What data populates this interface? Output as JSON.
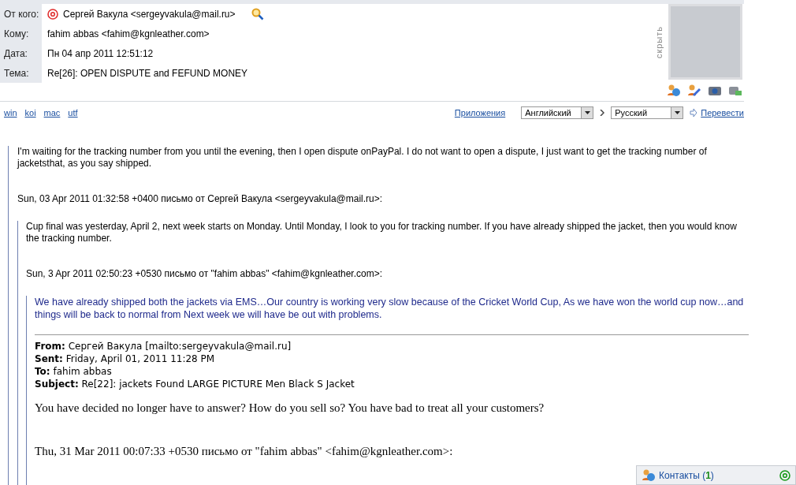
{
  "header": {
    "fields": [
      {
        "kind": "sender",
        "label": "От кого:",
        "value": "Сергей Вакула <sergeyvakula@mail.ru>"
      },
      {
        "kind": "plain",
        "label": "Кому:",
        "value": "fahim abbas <fahim@kgnleather.com>"
      },
      {
        "kind": "plain",
        "label": "Дата:",
        "value": "Пн 04 апр 2011 12:51:12"
      },
      {
        "kind": "plain",
        "label": "Тема:",
        "value": "Re[26]: OPEN DISPUTE and FEFUND MONEY"
      }
    ],
    "hide_label": "скрыть"
  },
  "toolbar": {
    "encodings": [
      "win",
      "koi",
      "mac",
      "utf"
    ],
    "attachments": "Приложения",
    "source_language": "Английский",
    "target_language": "Русский",
    "translate": "Перевести"
  },
  "body": {
    "text": "I'm waiting for the tracking number from you until the evening, then I open dispute onPayPal. I do not want to open a dispute, I just want to get the tracking number of jacketsthat, as you say shipped.",
    "quote": {
      "header": "Sun, 03 Apr 2011 01:32:58 +0400 письмо от Сергей Вакула <sergeyvakula@mail.ru>:",
      "text": "Cup final was yesterday, April 2, next week starts on Monday. Until Monday, I look to you for tracking number. If you have already shipped the jacket, then you would know the tracking number.",
      "quote": {
        "header": "Sun, 3 Apr 2011 02:50:23 +0530 письмо от \"fahim abbas\" <fahim@kgnleather.com>:",
        "text": "We have already shipped both the jackets via EMS…Our country is working very slow because of the Cricket World Cup, As we have won the world cup now…and things will be back to normal from Next week we will have be out with problems.",
        "forwarded": [
          "**From:** Сергей Вакула [mailto:sergeyvakula@mail.ru]",
          "**Sent:** Friday, April 01, 2011 11:28 PM",
          "**To:** fahim abbas",
          "**Subject:** Re[22]: jackets Found LARGE PICTURE Men Black S Jacket"
        ],
        "message": "You have decided no longer have to answer? How do you sell so? You have bad to treat all your customers?",
        "next_header": "Thu, 31 Mar 2011 00:07:33 +0530 письмо от \"fahim abbas\" <fahim@kgnleather.com>:"
      }
    }
  },
  "contacts": {
    "label": "Контакты (**1**)"
  }
}
